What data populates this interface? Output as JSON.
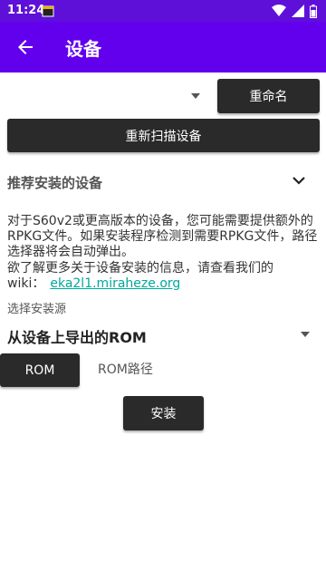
{
  "status_bar": {
    "time": "11:24"
  },
  "app_bar": {
    "title": "设备"
  },
  "device_row": {
    "rename_label": "重命名"
  },
  "rescan_label": "重新扫描设备",
  "recommended": {
    "title": "推荐安装的设备",
    "line1": "对于S60v2或更高版本的设备，您可能需要提供额外的",
    "line2": "RPKG文件。如果安装程序检测到需要RPKG文件，路径",
    "line3": "选择器将会自动弹出。",
    "line4": "欲了解更多关于设备安装的信息，请查看我们的",
    "wiki_prefix": "wiki：",
    "wiki_link": "eka2l1.miraheze.org"
  },
  "install_source": {
    "label": "选择安装源",
    "selected": "从设备上导出的ROM",
    "rom_button": "ROM",
    "rom_path_label": "ROM路径",
    "install_button": "安装"
  }
}
